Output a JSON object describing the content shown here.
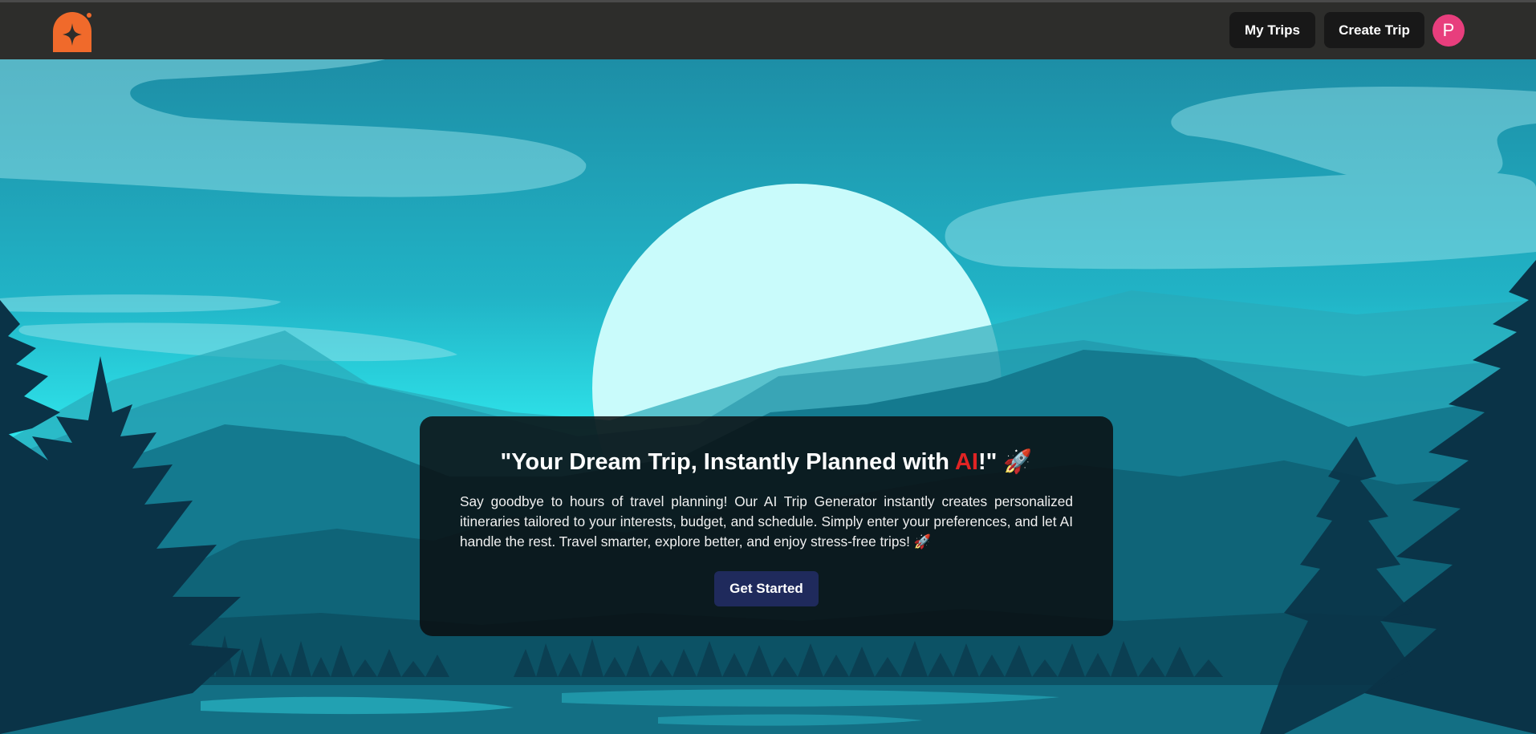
{
  "header": {
    "logo_icon": "sparkle-arch-logo",
    "brand_color": "#f06a2b",
    "my_trips_label": "My Trips",
    "create_trip_label": "Create Trip",
    "avatar_initial": "P",
    "avatar_color": "#e83e7d"
  },
  "hero": {
    "title_prefix": "\"Your Dream Trip, Instantly Planned with ",
    "title_highlight": "AI",
    "title_suffix": "!\" 🚀",
    "highlight_color": "#e02424",
    "description": "Say goodbye to hours of travel planning! Our AI Trip Generator instantly creates personalized itineraries tailored to your interests, budget, and schedule. Simply enter your preferences, and let AI handle the rest. Travel smarter, explore better, and enjoy stress-free trips! 🚀",
    "cta_label": "Get Started",
    "cta_color": "#1f2a5c"
  }
}
